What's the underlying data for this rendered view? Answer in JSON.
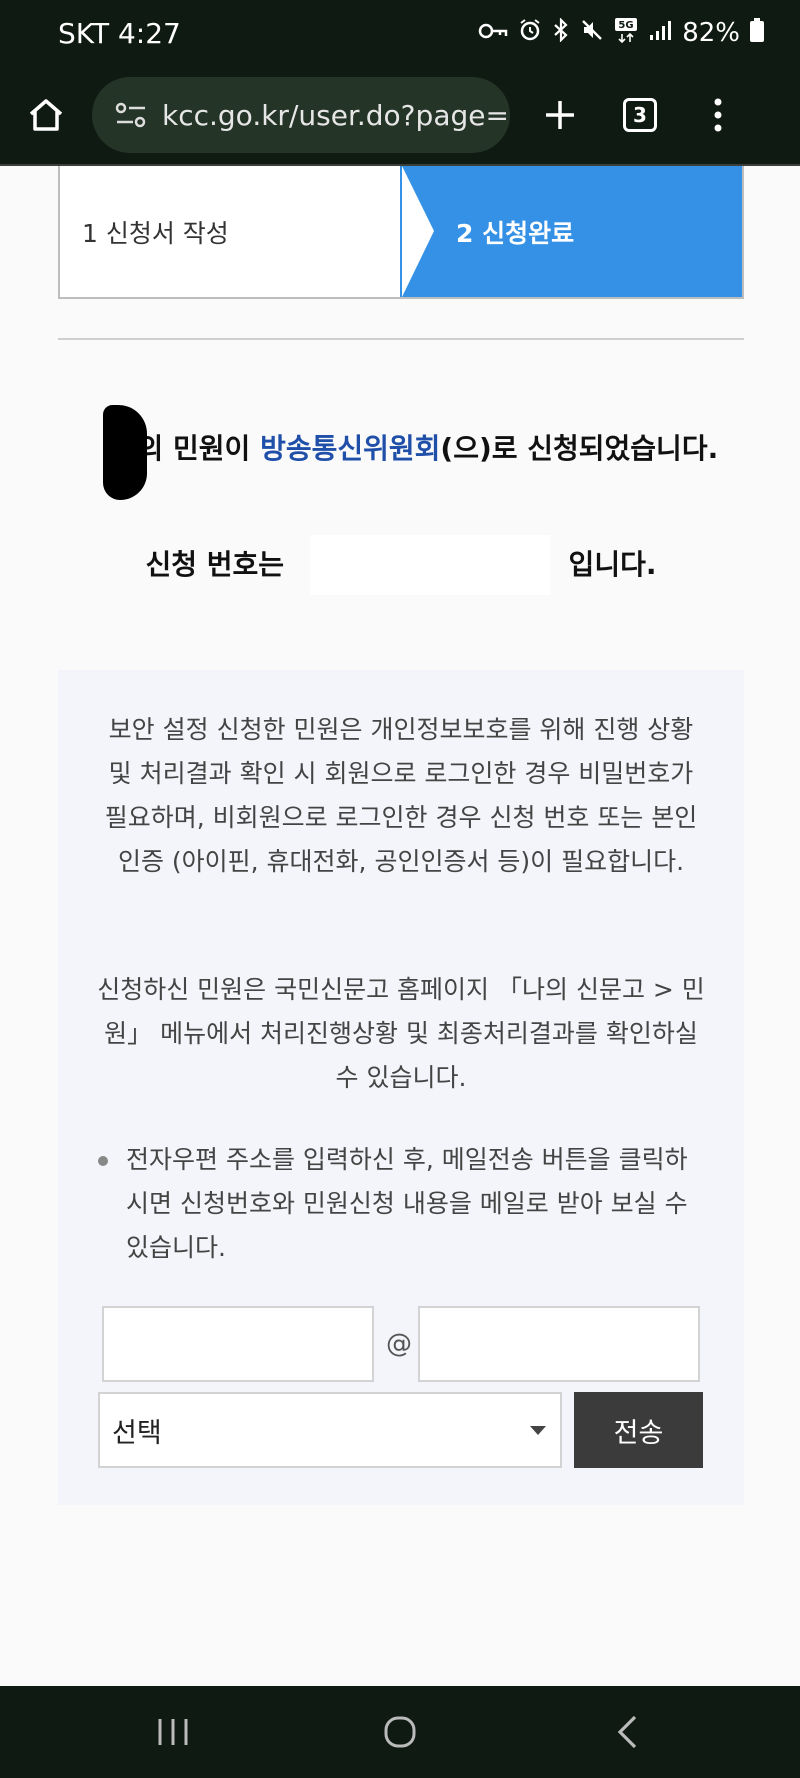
{
  "status_bar": {
    "carrier_time": "SKT 4:27",
    "battery": "82%",
    "icons": [
      "key-icon",
      "alarm-icon",
      "bluetooth-icon",
      "mute-icon",
      "5g-icon",
      "signal-icon",
      "battery-icon"
    ]
  },
  "browser": {
    "url": "kcc.go.kr/user.do?page=",
    "tab_count": "3"
  },
  "steps": {
    "step1": "1 신청서 작성",
    "step2": "2 신청완료",
    "active_color": "#3591e6"
  },
  "result": {
    "line_before_name": "",
    "line_suffix": "님의 민원이 ",
    "org": "방송통신위원회",
    "line_rest": "(으)로 신청되었습니다.",
    "appno_prefix": "신청 번호는 ",
    "appno_suffix": " 입니다."
  },
  "info": {
    "para1": "보안 설정 신청한 민원은 개인정보보호를 위해 진행 상황 및 처리결과 확인 시 회원으로 로그인한 경우 비밀번호가 필요하며, 비회원으로 로그인한 경우 신청 번호 또는 본인인증 (아이핀, 휴대전화, 공인인증서 등)이 필요합니다.",
    "para2": "신청하신 민원은 국민신문고 홈페이지 「나의 신문고 > 민원」 메뉴에서 처리진행상황 및 최종처리결과를 확인하실 수 있습니다.",
    "bullet": "전자우편 주소를 입력하신 후, 메일전송 버튼을 클릭하시면 신청번호와 민원신청 내용을 메일로 받아 보실 수 있습니다."
  },
  "email_form": {
    "local_value": "",
    "at": "@",
    "domain_value": "",
    "select_value": "선택",
    "send_label": "전송"
  }
}
